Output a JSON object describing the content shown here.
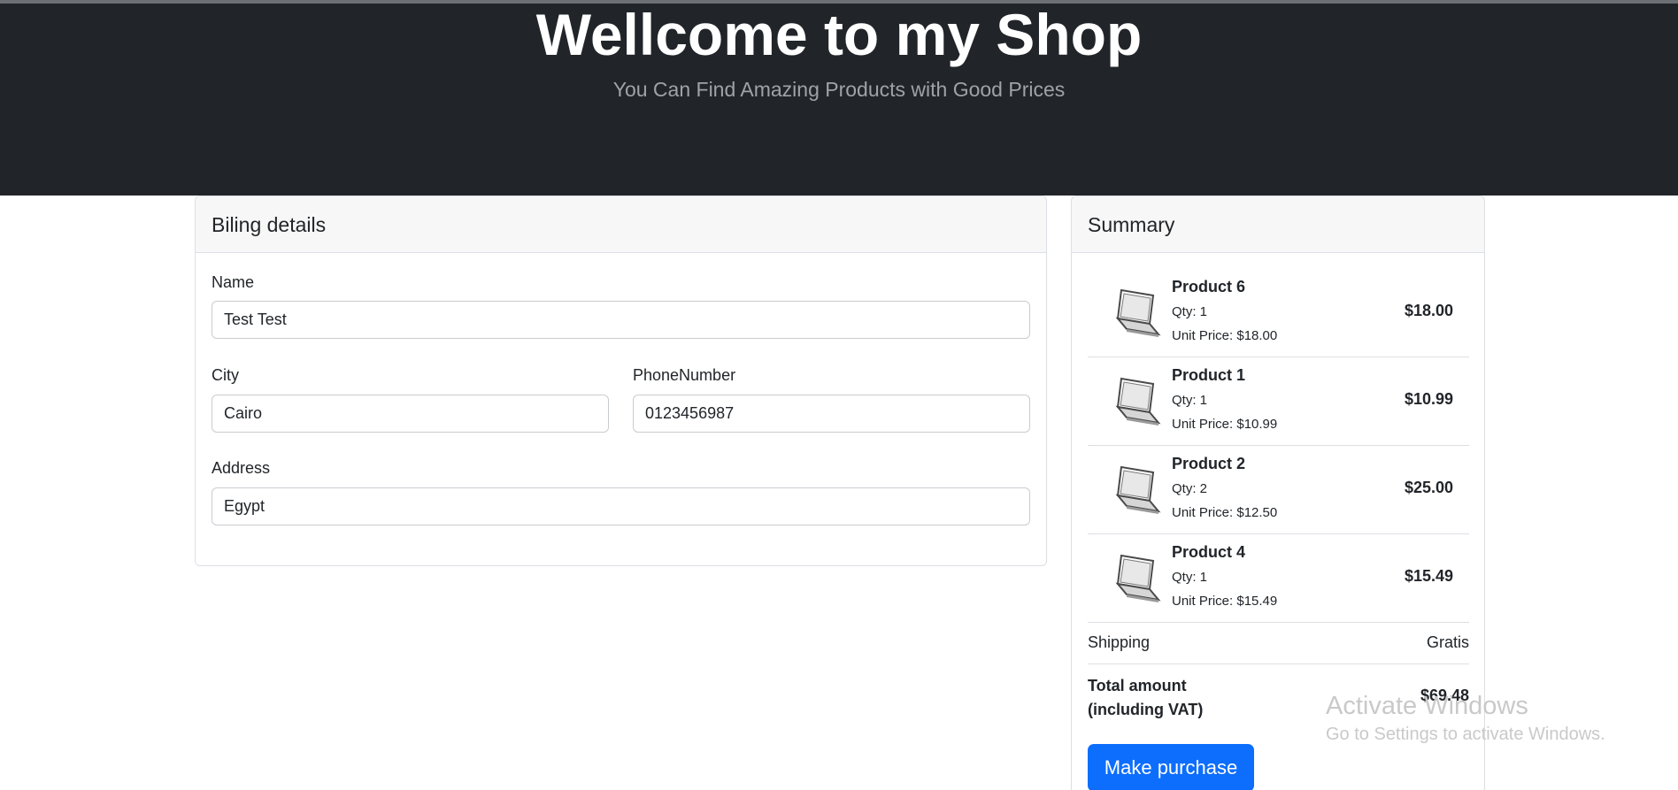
{
  "header": {
    "title": "Wellcome to my Shop",
    "subtitle": "You Can Find Amazing Products with Good Prices"
  },
  "billing": {
    "title": "Biling details",
    "name_label": "Name",
    "name_value": "Test Test",
    "city_label": "City",
    "city_value": "Cairo",
    "phone_label": "PhoneNumber",
    "phone_value": "0123456987",
    "address_label": "Address",
    "address_value": "Egypt"
  },
  "summary": {
    "title": "Summary",
    "items": [
      {
        "name": "Product 6",
        "qty": "Qty: 1",
        "unit_price": "Unit Price: $18.00",
        "price": "$18.00",
        "icon": "laptop-icon"
      },
      {
        "name": "Product 1",
        "qty": "Qty: 1",
        "unit_price": "Unit Price: $10.99",
        "price": "$10.99",
        "icon": "laptop-icon"
      },
      {
        "name": "Product 2",
        "qty": "Qty: 2",
        "unit_price": "Unit Price: $12.50",
        "price": "$25.00",
        "icon": "laptop-icon"
      },
      {
        "name": "Product 4",
        "qty": "Qty: 1",
        "unit_price": "Unit Price: $15.49",
        "price": "$15.49",
        "icon": "laptop-icon"
      }
    ],
    "shipping_label": "Shipping",
    "shipping_value": "Gratis",
    "total_label": "Total amount (including VAT)",
    "total_value": "$69.48",
    "purchase_button": "Make purchase"
  },
  "watermark": {
    "line1": "Activate Windows",
    "line2": "Go to Settings to activate Windows."
  },
  "colors": {
    "hero_bg": "#212529",
    "primary": "#0d6efd"
  }
}
